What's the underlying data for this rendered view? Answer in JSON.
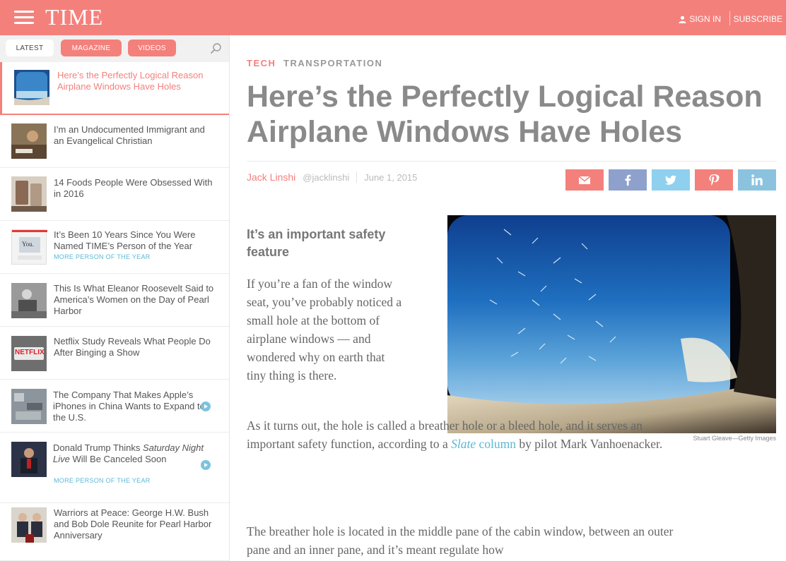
{
  "header": {
    "logo": "TIME",
    "sign_in": "SIGN IN",
    "subscribe": "SUBSCRIBE"
  },
  "sidebar": {
    "tabs": [
      "LATEST",
      "MAGAZINE",
      "VIDEOS"
    ],
    "items": [
      {
        "title": "Here’s the Perfectly Logical Reason Airplane Windows Have Holes",
        "active": true
      },
      {
        "title": "I’m an Undocumented Immigrant and an Evangelical Christian"
      },
      {
        "title": "14 Foods People Were Obsessed With in 2016"
      },
      {
        "title": "It’s Been 10 Years Since You Were Named TIME’s Person of the Year",
        "tag": "MORE PERSON OF THE YEAR",
        "thumb_text": "You."
      },
      {
        "title": "This Is What Eleanor Roosevelt Said to America’s Women on the Day of Pearl Harbor"
      },
      {
        "title": "Netflix Study Reveals What People Do After Binging a Show",
        "thumb_text": "NETFLIX"
      },
      {
        "title": "The Company That Makes Apple’s iPhones in China Wants to Expand to the U.S.",
        "video": true
      },
      {
        "title_pre": "Donald Trump Thinks ",
        "title_em": "Saturday Night Live",
        "title_post": " Will Be Canceled Soon",
        "tag": "MORE PERSON OF THE YEAR",
        "video": true
      },
      {
        "title": "Warriors at Peace: George H.W. Bush and Bob Dole Reunite for Pearl Harbor Anniversary"
      }
    ]
  },
  "article": {
    "section": "TECH",
    "subsection": "TRANSPORTATION",
    "headline": "Here’s the Perfectly Logical Reason Airplane Windows Have Holes",
    "author": "Jack Linshi",
    "handle": "@jacklinshi",
    "date": "June 1, 2015",
    "photo_credit": "Stuart Gleave—Getty Images",
    "dek": "It’s an important safety feature",
    "p1": "If you’re a fan of the window seat, you’ve probably noticed a small hole at the bottom of airplane windows — and wondered why on earth that tiny thing is there.",
    "p2_a": "As it turns out, the hole is called a breather hole or a bleed hole, and it serves an important safety function, according to a ",
    "p2_link_em": "Slate",
    "p2_link_rest": " column",
    "p2_b": " by pilot Mark Vanhoenacker.",
    "p3": "The breather hole is located in the middle pane of the cabin window, between an outer pane and an inner pane, and it’s meant regulate how"
  },
  "colors": {
    "brand": "#f4807c",
    "link": "#5bb8d4"
  },
  "icons": [
    "menu-icon",
    "user-icon",
    "search-icon",
    "mail-icon",
    "facebook-icon",
    "twitter-icon",
    "pinterest-icon",
    "linkedin-icon",
    "play-icon"
  ]
}
